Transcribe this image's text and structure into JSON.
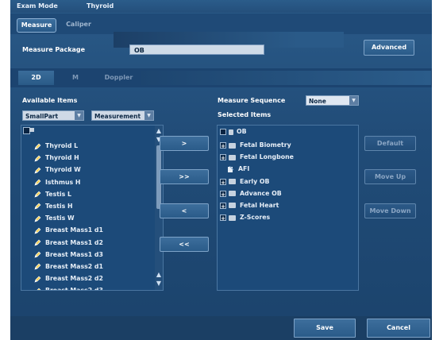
{
  "topbar": {
    "exam_mode_label": "Exam Mode",
    "exam_value": "Thyroid"
  },
  "tabs": [
    {
      "label": "Measure",
      "active": true
    },
    {
      "label": "Caliper",
      "active": false
    }
  ],
  "measure_package": {
    "label": "Measure Package",
    "value": "OB"
  },
  "advanced_label": "Advanced",
  "mode_tabs": [
    {
      "label": "2D",
      "active": true
    },
    {
      "label": "M",
      "active": false
    },
    {
      "label": "Doppler",
      "active": false
    }
  ],
  "available": {
    "label": "Available Items",
    "group_select": "SmallPart",
    "type_select": "Measurement",
    "items": [
      "Thyroid L",
      "Thyroid H",
      "Thyroid W",
      "Isthmus H",
      "Testis L",
      "Testis H",
      "Testis W",
      "Breast Mass1 d1",
      "Breast Mass1 d2",
      "Breast Mass1 d3",
      "Breast Mass2 d1",
      "Breast Mass2 d2",
      "Breast Mass2 d3"
    ]
  },
  "transfer_buttons": {
    "add": ">",
    "add_all": ">>",
    "remove": "<",
    "remove_all": "<<"
  },
  "sequence": {
    "label": "Measure Sequence",
    "value": "None"
  },
  "selected": {
    "label": "Selected Items",
    "root": "OB",
    "items": [
      {
        "label": "Fetal Biometry",
        "kind": "plus"
      },
      {
        "label": "Fetal Longbone",
        "kind": "plus"
      },
      {
        "label": "AFI",
        "kind": "leaf"
      },
      {
        "label": "Early OB",
        "kind": "plus"
      },
      {
        "label": "Advance OB",
        "kind": "plus"
      },
      {
        "label": "Fetal Heart",
        "kind": "plus"
      },
      {
        "label": "Z-Scores",
        "kind": "plus"
      }
    ]
  },
  "side_buttons": {
    "default": "Default",
    "move_up": "Move Up",
    "move_down": "Move Down"
  },
  "footer": {
    "save": "Save",
    "cancel": "Cancel"
  },
  "colors": {
    "background": "#214c78",
    "field": "#cfdbe8",
    "list_bg": "#1c4a79"
  }
}
